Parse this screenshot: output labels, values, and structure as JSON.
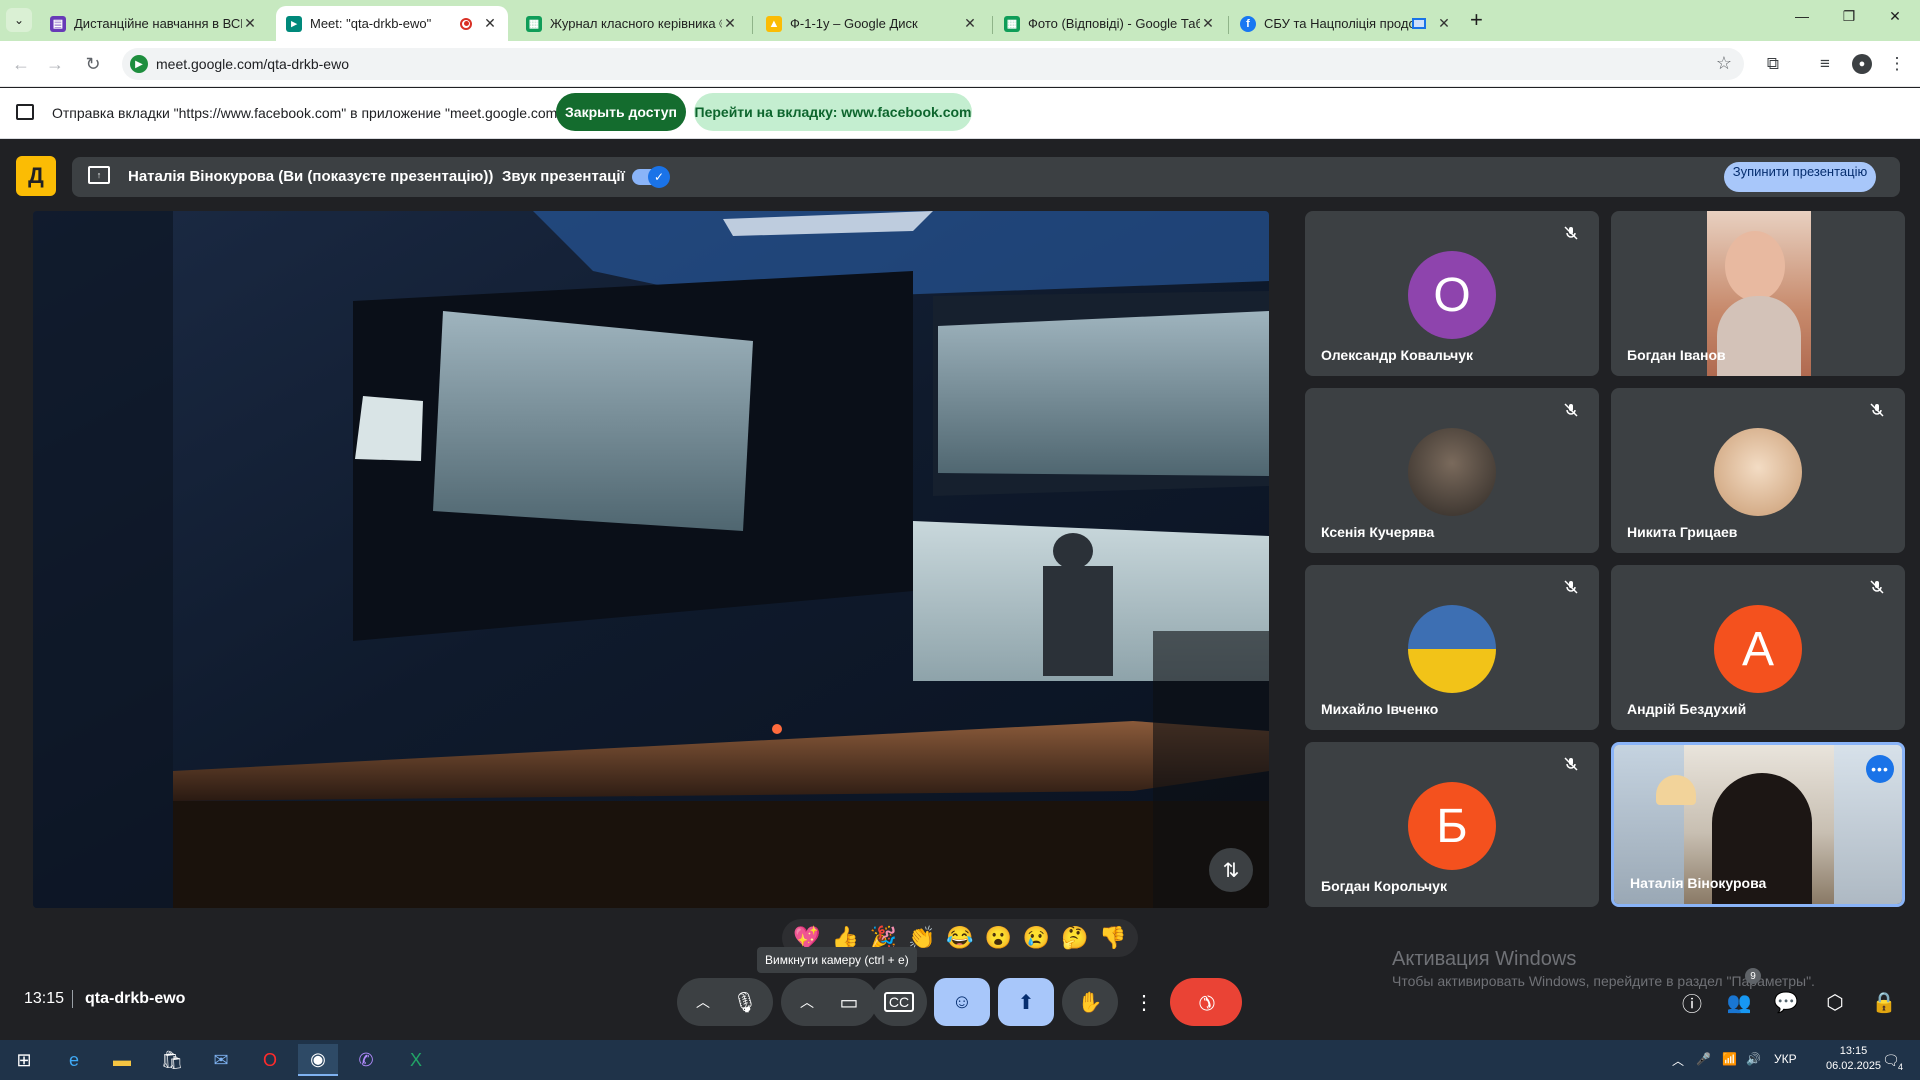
{
  "browser": {
    "tabs": [
      {
        "title": "Дистанційне навчання в ВСП",
        "favicon": "forms-icon",
        "color": "#673ab7"
      },
      {
        "title": "Meet: \"qta-drkb-ewo\"",
        "favicon": "meet-icon",
        "color": "#00897b"
      },
      {
        "title": "Журнал класного керівника ©",
        "favicon": "sheets-icon",
        "color": "#0f9d58"
      },
      {
        "title": "Ф-1-1у – Google Диск",
        "favicon": "drive-icon",
        "color": "#fbbc04"
      },
      {
        "title": "Фото (Відповіді) - Google Табл",
        "favicon": "sheets-icon",
        "color": "#0f9d58"
      },
      {
        "title": "СБУ та Нацполіція продов",
        "favicon": "facebook-icon",
        "color": "#1877f2"
      }
    ],
    "url": "meet.google.com/qta-drkb-ewo"
  },
  "sharebar": {
    "message": "Отправка вкладки \"https://www.facebook.com\" в приложение \"meet.google.com\"...",
    "stop_label": "Закрыть доступ",
    "goto_label": "Перейти на вкладку: www.facebook.com"
  },
  "presentation": {
    "presenter_text": "Наталія Вінокурова (Ви (показуєте презентацію))",
    "audio_label": "Звук презентації",
    "audio_on": true,
    "stop_label": "Зупинити презентацію"
  },
  "participants": [
    {
      "name": "Олександр Ковальчук",
      "initial": "О",
      "avatar_color": "#8e44ad",
      "muted": true
    },
    {
      "name": "Богдан Іванов",
      "initial": "",
      "avatar_color": "#c78a6c",
      "muted": false
    },
    {
      "name": "Ксенія Кучерява",
      "initial": "",
      "avatar_color": "#6b5a4c",
      "muted": true
    },
    {
      "name": "Никита Грицаев",
      "initial": "",
      "avatar_color": "#d7b79a",
      "muted": true
    },
    {
      "name": "Михайло Івченко",
      "initial": "",
      "avatar_color": "#3d6fb3",
      "muted": true
    },
    {
      "name": "Андрій Бездухий",
      "initial": "А",
      "avatar_color": "#f4511e",
      "muted": true
    },
    {
      "name": "Богдан Корольчук",
      "initial": "Б",
      "avatar_color": "#f4511e",
      "muted": true
    },
    {
      "name": "Наталія Вінокурова",
      "initial": "",
      "avatar_color": "#8a7a66",
      "muted": false
    }
  ],
  "reactions": [
    "💖",
    "👍",
    "🎉",
    "👏",
    "😂",
    "😮",
    "😢",
    "🤔",
    "👎"
  ],
  "tooltip": "Вимкнути камеру (ctrl + e)",
  "watermark": {
    "title": "Активация Windows",
    "subtitle": "Чтобы активировать Windows, перейдите в раздел \"Параметры\"."
  },
  "meeting": {
    "time": "13:15",
    "code": "qta-drkb-ewo",
    "people_count": "9"
  },
  "taskbar": {
    "lang": "УКР",
    "time": "13:15",
    "date": "06.02.2025",
    "notifications": "4"
  }
}
